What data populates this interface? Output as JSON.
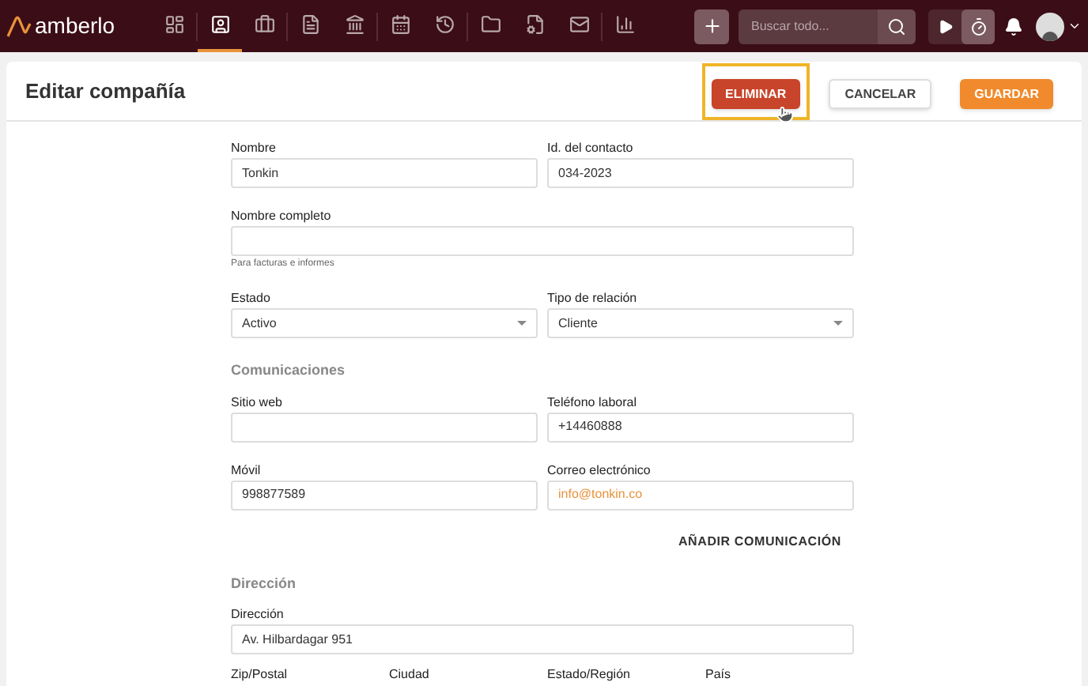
{
  "brand": "amberlo",
  "nav": [
    {
      "selected": false
    },
    {
      "selected": true
    },
    {
      "selected": false
    },
    {
      "selected": false
    },
    {
      "selected": false
    },
    {
      "selected": false
    },
    {
      "selected": false
    },
    {
      "selected": false
    },
    {
      "selected": false
    },
    {
      "selected": false
    },
    {
      "selected": false
    }
  ],
  "search": {
    "placeholder": "Buscar todo..."
  },
  "page_title": "Editar compañía",
  "actions": [
    {
      "label": "ELIMINAR",
      "kind": "danger",
      "highlighted": true
    },
    {
      "label": "CANCELAR",
      "kind": "plain",
      "highlighted": false
    },
    {
      "label": "GUARDAR",
      "kind": "primary",
      "highlighted": false
    }
  ],
  "sections": [
    {
      "rows": [
        [
          {
            "label": "Nombre",
            "value": "Tonkin",
            "kind": "text"
          },
          {
            "label": "Id. del contacto",
            "value": "034-2023",
            "kind": "text"
          }
        ],
        [
          {
            "label": "Nombre completo",
            "kind": "text",
            "hint": "Para facturas e informes"
          }
        ],
        [
          {
            "label": "Estado",
            "value": "Activo",
            "kind": "select"
          },
          {
            "label": "Tipo de relación",
            "value": "Cliente",
            "kind": "select"
          }
        ]
      ]
    },
    {
      "heading": "Comunicaciones",
      "rows": [
        [
          {
            "label": "Sitio web",
            "kind": "text"
          },
          {
            "label": "Teléfono laboral",
            "value": "+14460888",
            "kind": "text"
          }
        ],
        [
          {
            "label": "Móvil",
            "value": "998877589",
            "kind": "text"
          },
          {
            "label": "Correo electrónico",
            "value": "info@tonkin.co",
            "kind": "email"
          }
        ]
      ],
      "action": "AÑADIR COMUNICACIÓN"
    },
    {
      "heading": "Dirección",
      "rows": [
        [
          {
            "label": "Dirección",
            "value": "Av. Hilbardagar 951",
            "kind": "text"
          }
        ]
      ],
      "cut_labels": [
        "Zip/Postal",
        "Ciudad",
        "Estado/Región",
        "País"
      ]
    }
  ]
}
